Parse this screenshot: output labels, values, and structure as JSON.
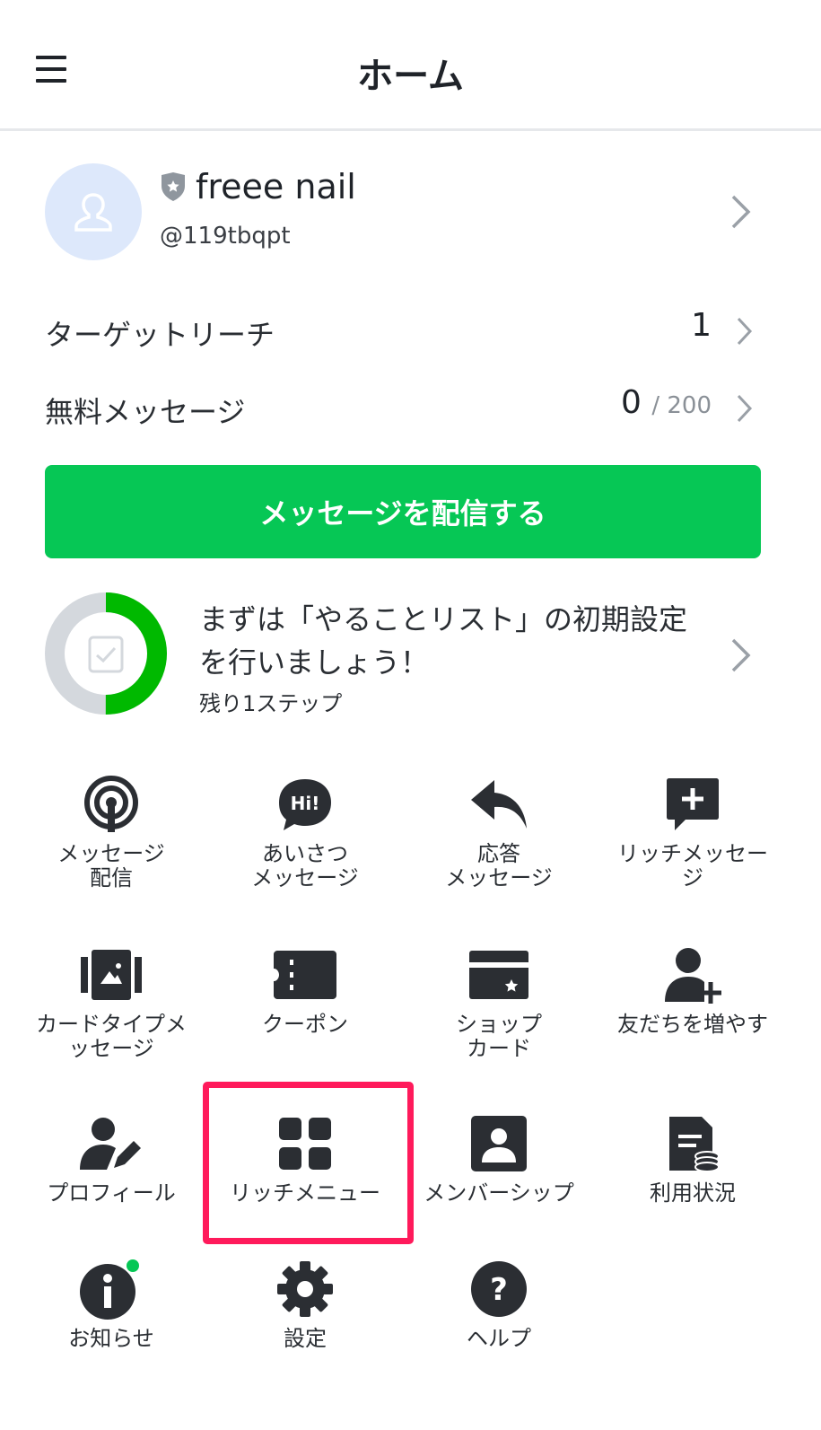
{
  "header": {
    "title": "ホーム"
  },
  "account": {
    "name": "freee nail",
    "id": "@119tbqpt"
  },
  "stats": {
    "target_reach": {
      "label": "ターゲットリーチ",
      "value": "1"
    },
    "free_messages": {
      "label": "無料メッセージ",
      "value": "0",
      "limit": "/ 200"
    }
  },
  "send_button": {
    "label": "メッセージを配信する"
  },
  "todo": {
    "title_line1": "まずは「やることリスト」の初期設定",
    "title_line2": "を行いましょう！",
    "subtitle": "残り1ステップ",
    "progress": 0.5
  },
  "grid": [
    {
      "line1": "メッセージ",
      "line2": "配信",
      "icon": "broadcast-icon"
    },
    {
      "line1": "あいさつ",
      "line2": "メッセージ",
      "icon": "greeting-icon"
    },
    {
      "line1": "応答",
      "line2": "メッセージ",
      "icon": "reply-icon"
    },
    {
      "line1": "リッチメッセー",
      "line2": "ジ",
      "icon": "rich-message-icon"
    },
    {
      "line1": "カードタイプメ",
      "line2": "ッセージ",
      "icon": "card-type-icon"
    },
    {
      "line1": "クーポン",
      "line2": "",
      "icon": "coupon-icon"
    },
    {
      "line1": "ショップ",
      "line2": "カード",
      "icon": "shop-card-icon"
    },
    {
      "line1": "友だちを増やす",
      "line2": "",
      "icon": "add-friend-icon"
    },
    {
      "line1": "プロフィール",
      "line2": "",
      "icon": "profile-icon"
    },
    {
      "line1": "リッチメニュー",
      "line2": "",
      "icon": "rich-menu-icon"
    },
    {
      "line1": "メンバーシップ",
      "line2": "",
      "icon": "membership-icon"
    },
    {
      "line1": "利用状況",
      "line2": "",
      "icon": "usage-icon"
    },
    {
      "line1": "お知らせ",
      "line2": "",
      "icon": "info-icon"
    },
    {
      "line1": "設定",
      "line2": "",
      "icon": "settings-icon"
    },
    {
      "line1": "ヘルプ",
      "line2": "",
      "icon": "help-icon"
    }
  ],
  "colors": {
    "brand_green": "#06c755",
    "highlight": "#ff1a5b",
    "icon_dark": "#2b2e33",
    "notification_dot": "#06c755"
  }
}
